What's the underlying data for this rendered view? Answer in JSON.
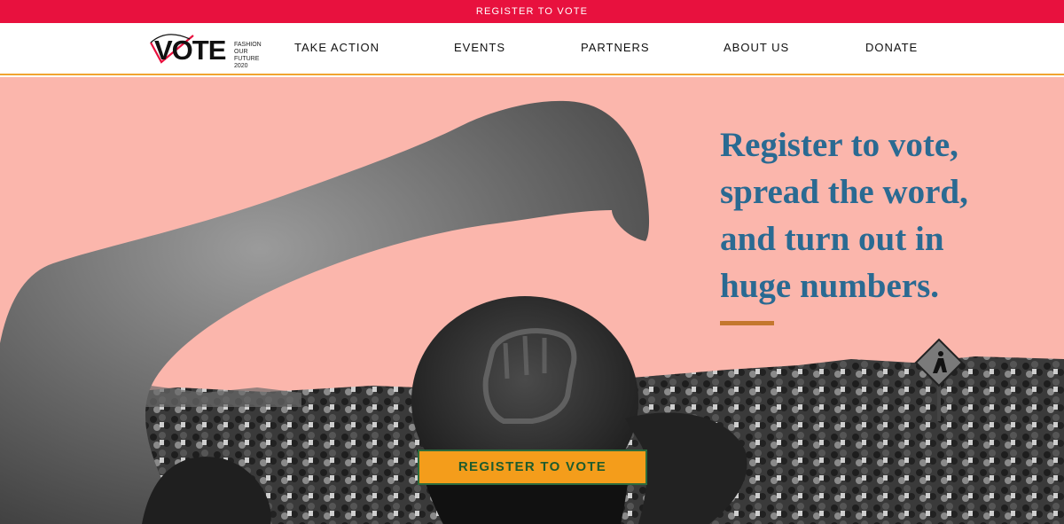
{
  "banner": {
    "text": "REGISTER TO VOTE"
  },
  "logo": {
    "word": "VOTE",
    "tagline": [
      "FASHION",
      "OUR",
      "FUTURE",
      "2020"
    ]
  },
  "nav": {
    "items": [
      {
        "label": "TAKE ACTION"
      },
      {
        "label": "EVENTS"
      },
      {
        "label": "PARTNERS"
      },
      {
        "label": "ABOUT US"
      },
      {
        "label": "DONATE"
      }
    ]
  },
  "hero": {
    "headline_lines": [
      "Register to vote,",
      "spread the word,",
      "and turn out in",
      "huge numbers."
    ],
    "cta_label": "REGISTER TO VOTE"
  },
  "colors": {
    "banner": "#e8113e",
    "hero_bg": "#fbb6ac",
    "headline": "#2a6a92",
    "accent_rule": "#c4772e",
    "cta_bg": "#f49d1b",
    "cta_text": "#1e5b2d",
    "nav_underline": "#f0a431"
  },
  "icons": [
    "fist-raised-image",
    "vote-check-mark",
    "pedestrian-sign"
  ]
}
